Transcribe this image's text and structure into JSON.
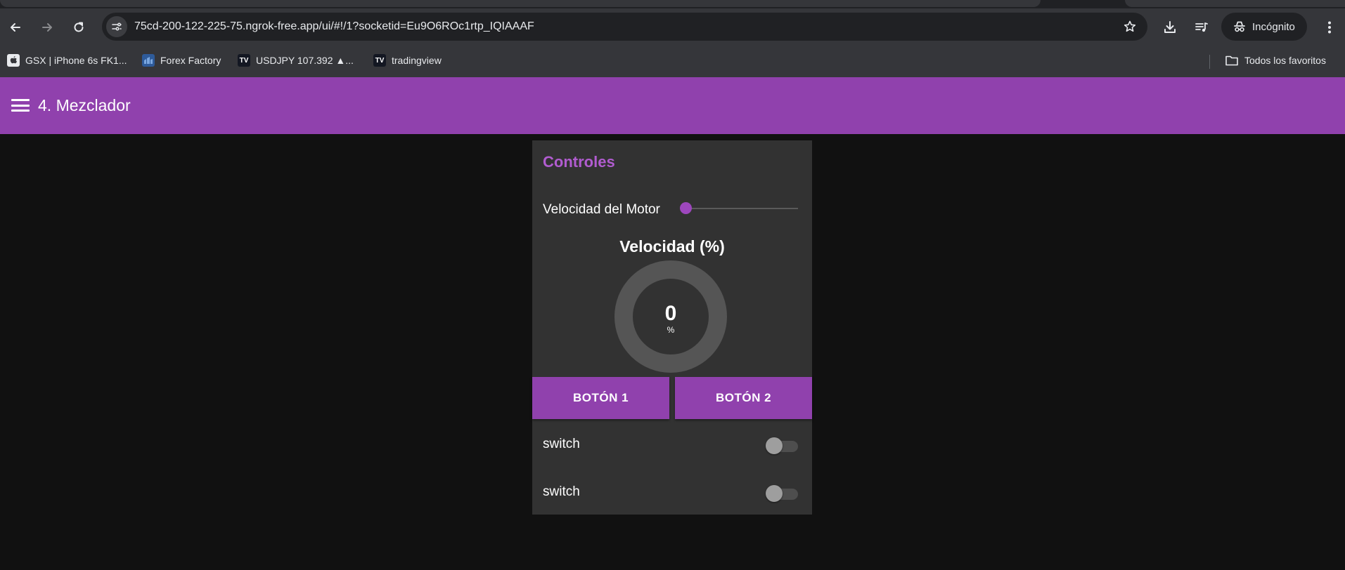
{
  "browser": {
    "url": "75cd-200-122-225-75.ngrok-free.app/ui/#!/1?socketid=Eu9O6ROc1rtp_IQIAAAF",
    "incognito_label": "Incógnito",
    "bookmarks": [
      {
        "label": "GSX | iPhone 6s FK1...",
        "icon": "apple-icon"
      },
      {
        "label": "Forex Factory",
        "icon": "forex-factory-icon"
      },
      {
        "label": "USDJPY 107.392 ▲...",
        "icon": "tradingview-icon"
      },
      {
        "label": "tradingview",
        "icon": "tradingview-icon"
      }
    ],
    "all_bookmarks_label": "Todos los favoritos"
  },
  "app": {
    "title": "4. Mezclador",
    "card_title": "Controles",
    "slider": {
      "label": "Velocidad del Motor",
      "value": 0
    },
    "gauge": {
      "title": "Velocidad (%)",
      "value": "0",
      "unit": "%",
      "fraction": 0
    },
    "buttons": [
      {
        "label": "BOTÓN 1"
      },
      {
        "label": "BOTÓN 2"
      }
    ],
    "switches": [
      {
        "label": "switch",
        "on": false
      },
      {
        "label": "switch",
        "on": false
      }
    ]
  },
  "colors": {
    "accent": "#9041ad",
    "card_title": "#b15cd0",
    "background": "#111111",
    "card": "#323232"
  }
}
